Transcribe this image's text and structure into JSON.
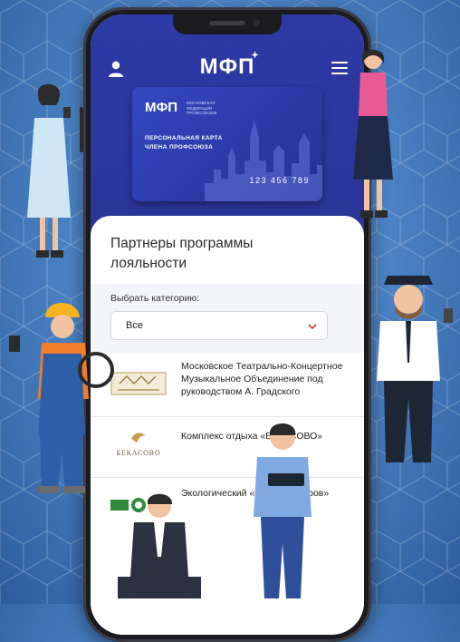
{
  "app": {
    "logo": "МФП",
    "colors": {
      "header": "#2d3aa6",
      "accent": "#d9363e",
      "background": "#4d86c8"
    }
  },
  "header": {
    "user_icon": "user-icon",
    "menu_icon": "hamburger-menu-icon"
  },
  "card": {
    "logo": "МФП",
    "logo_subtitle": "МОСКОВСКАЯ ФЕДЕРАЦИЯ ПРОФСОЮЗОВ",
    "title_line1": "ПЕРСОНАЛЬНАЯ КАРТА",
    "title_line2": "ЧЛЕНА ПРОФСОЮЗА",
    "number": "123 456 789"
  },
  "section": {
    "title": "Партнеры программы лояльности"
  },
  "category": {
    "label": "Выбрать категорию:",
    "selected": "Все"
  },
  "partners": [
    {
      "name": "Московское Театрально-Концертное Музыкальное Объединение под руководством А. Градского"
    },
    {
      "name": "Комплекс отдыха «БЕКАСОВО»",
      "logo_text": "БЕКАСОВО"
    },
    {
      "name": "Экологический «Марьин Остров»"
    }
  ]
}
